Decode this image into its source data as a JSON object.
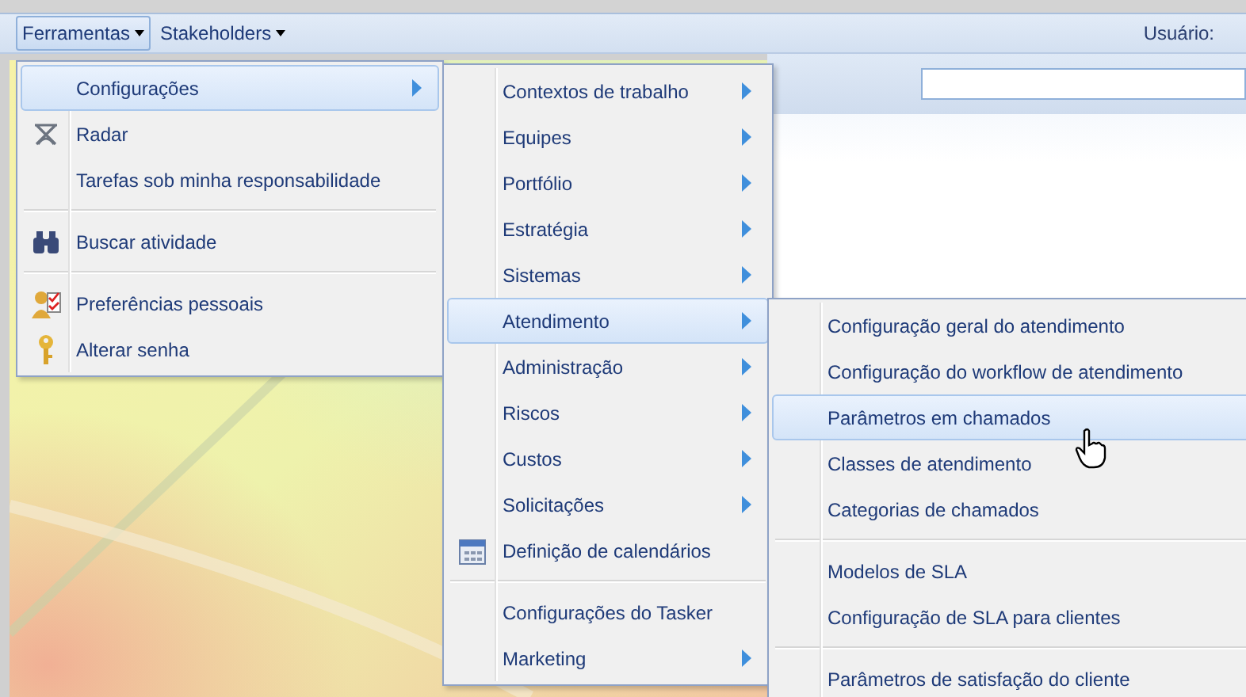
{
  "menubar": {
    "items": [
      {
        "label": "Ferramentas",
        "selected": true
      },
      {
        "label": "Stakeholders",
        "selected": false
      }
    ],
    "user_label": "Usuário:"
  },
  "menus": [
    {
      "groups": [
        [
          {
            "label": "Configurações",
            "selected": true,
            "submenu": true,
            "icon": false
          },
          {
            "label": "Radar",
            "selected": false,
            "submenu": false,
            "icon": true
          },
          {
            "label": "Tarefas sob minha responsabilidade",
            "selected": false,
            "submenu": false,
            "icon": false
          }
        ],
        [
          {
            "label": "Buscar atividade",
            "selected": false,
            "submenu": false,
            "icon": true
          }
        ],
        [
          {
            "label": "Preferências pessoais",
            "selected": false,
            "submenu": false,
            "icon": true
          },
          {
            "label": "Alterar senha",
            "selected": false,
            "submenu": false,
            "icon": true
          }
        ]
      ]
    },
    {
      "groups": [
        [
          {
            "label": "Contextos de trabalho",
            "selected": false,
            "submenu": true,
            "icon": false
          },
          {
            "label": "Equipes",
            "selected": false,
            "submenu": true,
            "icon": false
          },
          {
            "label": "Portfólio",
            "selected": false,
            "submenu": true,
            "icon": false
          },
          {
            "label": "Estratégia",
            "selected": false,
            "submenu": true,
            "icon": false
          },
          {
            "label": "Sistemas",
            "selected": false,
            "submenu": true,
            "icon": false
          },
          {
            "label": "Atendimento",
            "selected": true,
            "submenu": true,
            "icon": false
          },
          {
            "label": "Administração",
            "selected": false,
            "submenu": true,
            "icon": false
          },
          {
            "label": "Riscos",
            "selected": false,
            "submenu": true,
            "icon": false
          },
          {
            "label": "Custos",
            "selected": false,
            "submenu": true,
            "icon": false
          },
          {
            "label": "Solicitações",
            "selected": false,
            "submenu": true,
            "icon": false
          },
          {
            "label": "Definição de calendários",
            "selected": false,
            "submenu": false,
            "icon": true
          }
        ],
        [
          {
            "label": "Configurações do Tasker",
            "selected": false,
            "submenu": false,
            "icon": false
          },
          {
            "label": "Marketing",
            "selected": false,
            "submenu": true,
            "icon": false
          }
        ]
      ]
    },
    {
      "groups": [
        [
          {
            "label": "Configuração geral do atendimento",
            "selected": false,
            "submenu": false,
            "icon": false
          },
          {
            "label": "Configuração do workflow de atendimento",
            "selected": false,
            "submenu": false,
            "icon": false
          },
          {
            "label": "Parâmetros em chamados",
            "selected": true,
            "submenu": false,
            "icon": false
          },
          {
            "label": "Classes de atendimento",
            "selected": false,
            "submenu": false,
            "icon": false
          },
          {
            "label": "Categorias de chamados",
            "selected": false,
            "submenu": false,
            "icon": false
          }
        ],
        [
          {
            "label": "Modelos de SLA",
            "selected": false,
            "submenu": false,
            "icon": false
          },
          {
            "label": "Configuração de SLA para clientes",
            "selected": false,
            "submenu": false,
            "icon": false
          }
        ],
        [
          {
            "label": "Parâmetros de satisfação do cliente",
            "selected": false,
            "submenu": false,
            "icon": false
          }
        ]
      ]
    }
  ]
}
